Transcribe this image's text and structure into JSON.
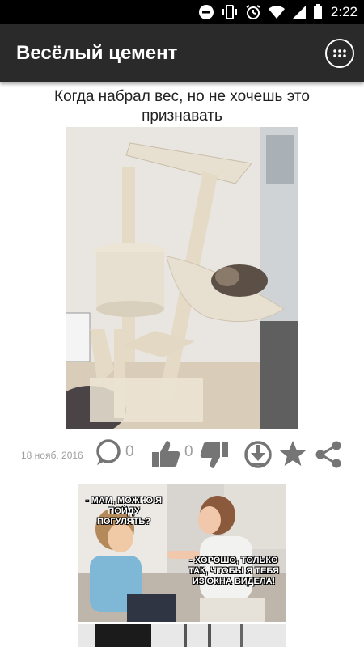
{
  "status_bar": {
    "time": "2:22",
    "icons": [
      "dnd-icon",
      "vibrate-icon",
      "alarm-icon",
      "wifi-icon",
      "signal-icon",
      "battery-icon"
    ]
  },
  "app_bar": {
    "title": "Весёлый цемент",
    "menu_icon": "grid-menu-icon"
  },
  "posts": [
    {
      "caption": "Когда набрал вес, но не хочешь это признавать",
      "image": "cat-tree-photo",
      "date": "18 нояб. 2016",
      "comments": "0",
      "likes": "0",
      "icons": [
        "comment-icon",
        "thumbs-up-icon",
        "thumbs-down-icon",
        "download-icon",
        "star-icon",
        "share-icon"
      ]
    },
    {
      "image": "mother-son-meme",
      "bubble_top": "- МАМ, МОЖНО Я ПОЙДУ ПОГУЛЯТЬ?",
      "bubble_bottom": "- ХОРОШО, ТОЛЬКО ТАК, ЧТОБЫ Я ТЕБЯ ИЗ ОКНА ВИДЕЛА!"
    }
  ],
  "colors": {
    "app_bar": "#2a2a2a",
    "action_icons": "#757575",
    "meta_text": "#9e9e9e"
  }
}
